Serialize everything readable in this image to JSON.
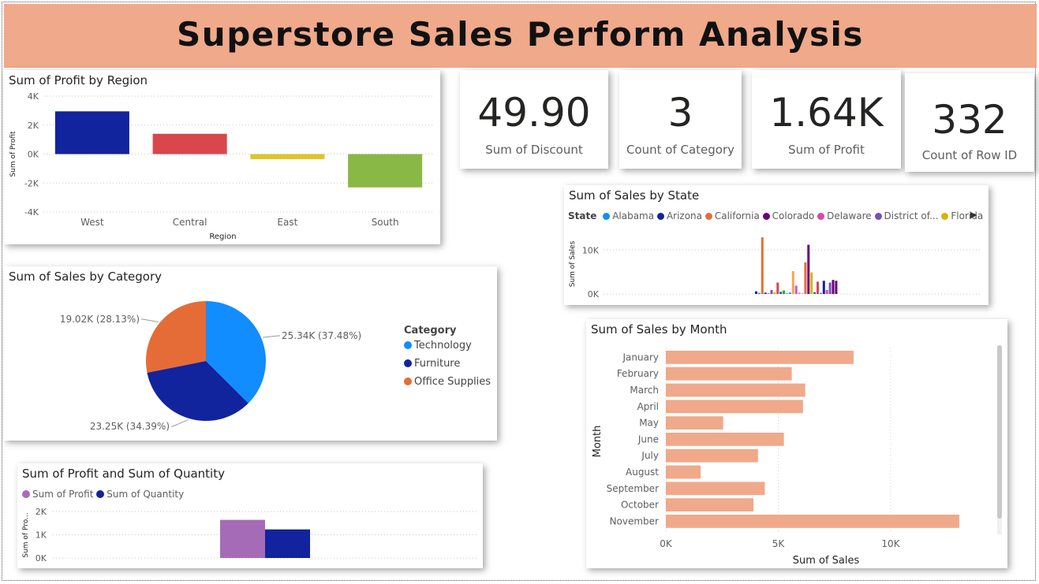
{
  "banner": {
    "title": "Superstore Sales Perform Analysis"
  },
  "colors": {
    "banner": "#f0a98a",
    "west": "#12239e",
    "central": "#d9464c",
    "east": "#e0c52b",
    "south": "#8ab846",
    "technology": "#118dff",
    "furniture": "#12239e",
    "office_supplies": "#e66c37",
    "profit": "#a66bb7",
    "quantity": "#12239e",
    "month_bar": "#f0a98a"
  },
  "profit_region": {
    "title": "Sum of Profit by Region",
    "ylabel": "Sum of Profit",
    "xlabel": "Region",
    "yticks": [
      "4K",
      "2K",
      "0K",
      "-2K",
      "-4K"
    ],
    "chart_data": {
      "type": "bar",
      "categories": [
        "West",
        "Central",
        "East",
        "South"
      ],
      "values": [
        2950,
        1400,
        -350,
        -2300
      ],
      "ylim": [
        -4000,
        4000
      ],
      "title": "Sum of Profit by Region",
      "xlabel": "Region",
      "ylabel": "Sum of Profit"
    }
  },
  "kpis": [
    {
      "value": "49.90",
      "label": "Sum of Discount"
    },
    {
      "value": "3",
      "label": "Count of Category"
    },
    {
      "value": "1.64K",
      "label": "Sum of Profit"
    },
    {
      "value": "332",
      "label": "Count of Row ID"
    }
  ],
  "sales_category": {
    "title": "Sum of Sales by Category",
    "legend_title": "Category",
    "chart_data": {
      "type": "pie",
      "categories": [
        "Technology",
        "Furniture",
        "Office Supplies"
      ],
      "values": [
        25340,
        23250,
        19020
      ],
      "percent": [
        37.48,
        34.39,
        28.13
      ],
      "data_labels": [
        "25.34K (37.48%)",
        "23.25K (34.39%)",
        "19.02K (28.13%)"
      ],
      "title": "Sum of Sales by Category",
      "legend_title": "Category",
      "legend_position": "right"
    }
  },
  "sales_state": {
    "title": "Sum of Sales by State",
    "legend_title": "State",
    "legend": [
      {
        "name": "Alabama",
        "color": "#118dff"
      },
      {
        "name": "Arizona",
        "color": "#12239e"
      },
      {
        "name": "California",
        "color": "#e66c37"
      },
      {
        "name": "Colorado",
        "color": "#6b007b"
      },
      {
        "name": "Delaware",
        "color": "#e044a7"
      },
      {
        "name": "District of...",
        "color": "#744ec2"
      },
      {
        "name": "Florida",
        "color": "#d9b300"
      }
    ],
    "ylabel": "Sum of Sales",
    "yticks": [
      "10K",
      "0K"
    ],
    "chart_data": {
      "type": "bar",
      "values": [
        600,
        250,
        12900,
        300,
        150,
        900,
        400,
        2600,
        500,
        800,
        200,
        350,
        5200,
        1900,
        300,
        150,
        7200,
        11200,
        4900,
        400,
        2800,
        250,
        3000,
        900,
        2600,
        3200,
        3000
      ],
      "colors": [
        "#12239e",
        "#118dff",
        "#e66c37",
        "#6b007b",
        "#e044a7",
        "#744ec2",
        "#d9b300",
        "#d64550",
        "#197278",
        "#1aab40",
        "#15c6f4",
        "#4092ff",
        "#ffa058",
        "#be5dc9",
        "#f472d0",
        "#b5a1ff",
        "#e66c37",
        "#6b007b",
        "#d9b300",
        "#197278",
        "#d64550",
        "#118dff",
        "#12239e",
        "#e044a7",
        "#744ec2",
        "#6b007b",
        "#6b007b"
      ],
      "ylim": [
        0,
        14000
      ],
      "title": "Sum of Sales by State",
      "ylabel": "Sum of Sales",
      "legend_title": "State",
      "legend_position": "top"
    }
  },
  "sales_month": {
    "title": "Sum of Sales by Month",
    "ylabel": "Month",
    "xlabel": "Sum of Sales",
    "xticks": [
      "0K",
      "5K",
      "10K"
    ],
    "chart_data": {
      "type": "bar",
      "categories": [
        "January",
        "February",
        "March",
        "April",
        "May",
        "June",
        "July",
        "August",
        "September",
        "October",
        "November"
      ],
      "values": [
        8350,
        5600,
        6200,
        6100,
        2550,
        5250,
        4100,
        1550,
        4400,
        3900,
        13050
      ],
      "xlim": [
        0,
        14000
      ],
      "title": "Sum of Sales by Month",
      "xlabel": "Sum of Sales",
      "ylabel": "Month"
    }
  },
  "profit_quantity": {
    "title": "Sum of Profit and Sum of Quantity",
    "ylabel": "Sum of Pro...",
    "yticks": [
      "2K",
      "1K",
      "0K"
    ],
    "legend": [
      "Sum of Profit",
      "Sum of Quantity"
    ],
    "chart_data": {
      "type": "bar",
      "series": [
        {
          "name": "Sum of Profit",
          "values": [
            1640
          ]
        },
        {
          "name": "Sum of Quantity",
          "values": [
            1230
          ]
        }
      ],
      "ylim": [
        0,
        2000
      ],
      "title": "Sum of Profit and Sum of Quantity",
      "ylabel": "Sum of Pro...",
      "legend_position": "top-left"
    }
  }
}
